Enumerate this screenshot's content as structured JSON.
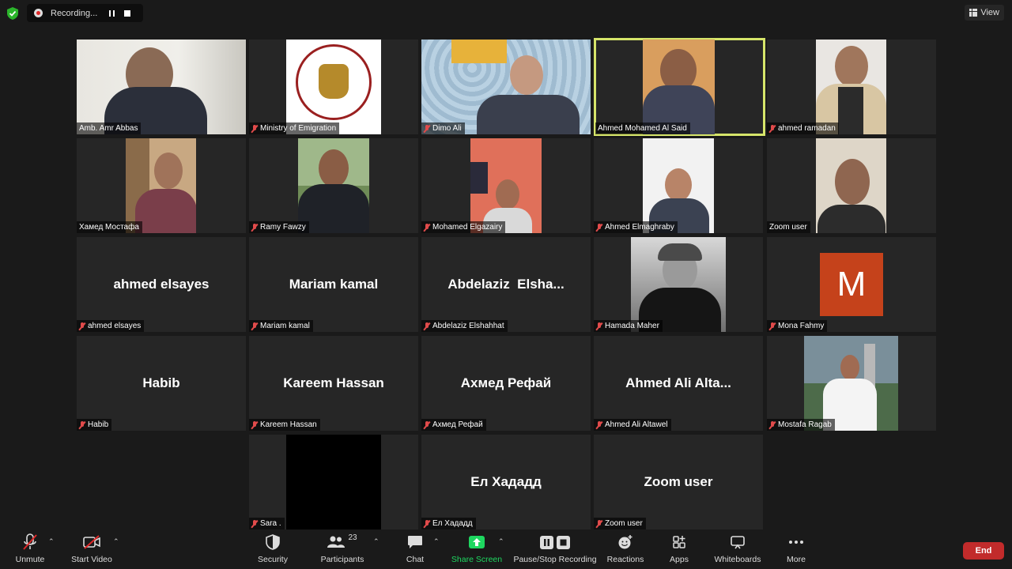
{
  "recording": {
    "label": "Recording..."
  },
  "view": {
    "label": "View"
  },
  "tiles": [
    {
      "center": "",
      "name": "Amb. Amr Abbas",
      "muted": false
    },
    {
      "center": "",
      "name": "Ministry of Emigration",
      "muted": true
    },
    {
      "center": "",
      "name": "Dimo Ali",
      "muted": true
    },
    {
      "center": "",
      "name": "Ahmed Mohamed Al Said",
      "muted": false,
      "active": true
    },
    {
      "center": "",
      "name": "ahmed ramadan",
      "muted": true
    },
    {
      "center": "",
      "name": "Хамед Мостафа",
      "muted": false
    },
    {
      "center": "",
      "name": "Ramy Fawzy",
      "muted": true
    },
    {
      "center": "",
      "name": "Mohamed Elgazairy",
      "muted": true
    },
    {
      "center": "",
      "name": "Ahmed Elmaghraby",
      "muted": true
    },
    {
      "center": "",
      "name": "Zoom user",
      "muted": false
    },
    {
      "center": "ahmed elsayes",
      "name": "ahmed elsayes",
      "muted": true
    },
    {
      "center": "Mariam kamal",
      "name": "Mariam kamal",
      "muted": true
    },
    {
      "center": "Abdelaziz  Elsha...",
      "name": "Abdelaziz Elshahhat",
      "muted": true
    },
    {
      "center": "",
      "name": "Hamada Maher",
      "muted": true
    },
    {
      "center": "",
      "name": "Mona Fahmy",
      "muted": true,
      "avatar": "M"
    },
    {
      "center": "Habib",
      "name": "Habib",
      "muted": true
    },
    {
      "center": "Kareem Hassan",
      "name": "Kareem Hassan",
      "muted": true
    },
    {
      "center": "Ахмед Рефай",
      "name": "Ахмед Рефай",
      "muted": true
    },
    {
      "center": "Ahmed Ali Alta...",
      "name": "Ahmed Ali Altawel",
      "muted": true
    },
    {
      "center": "",
      "name": "Mostafa Ragab",
      "muted": true
    },
    {
      "center": "",
      "name": "Sara .",
      "muted": true
    },
    {
      "center": "Ел Хададд",
      "name": "Ел Хададд",
      "muted": true
    },
    {
      "center": "Zoom user",
      "name": "Zoom user",
      "muted": true
    }
  ],
  "toolbar": {
    "unmute": "Unmute",
    "start_video": "Start Video",
    "security": "Security",
    "participants": "Participants",
    "participants_count": "23",
    "chat": "Chat",
    "share_screen": "Share Screen",
    "pause_stop": "Pause/Stop Recording",
    "reactions": "Reactions",
    "apps": "Apps",
    "whiteboards": "Whiteboards",
    "more": "More",
    "end": "End"
  },
  "colors": {
    "active_border": "#d6e56a",
    "end": "#c22b2b",
    "share": "#1ed760",
    "avatar_m": "#c5421b"
  }
}
